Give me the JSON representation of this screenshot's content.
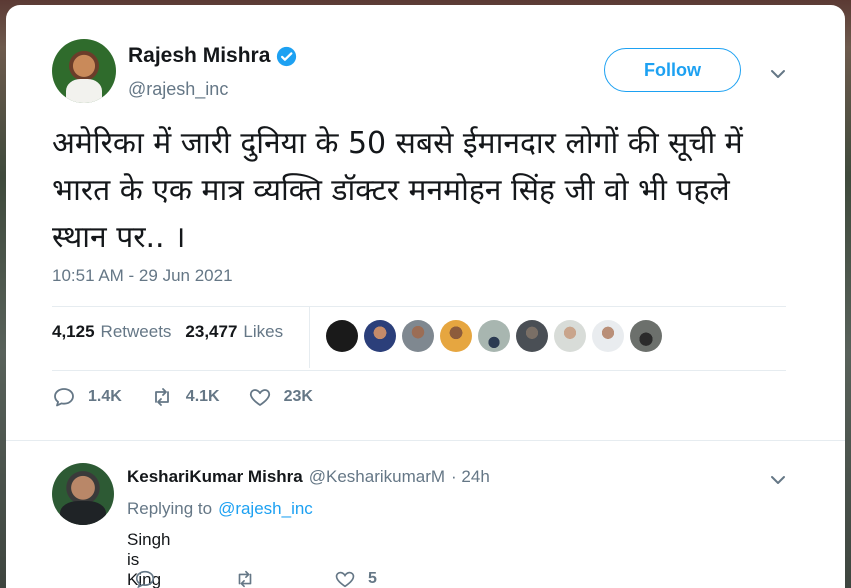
{
  "tweet": {
    "author_name": "Rajesh Mishra",
    "author_handle": "@rajesh_inc",
    "follow_label": "Follow",
    "text": "अमेरिका में जारी दुनिया के 50 सबसे ईमानदार लोगों की सूची में भारत के एक मात्र व्यक्ति डॉक्टर मनमोहन सिंह जी वो भी पहले स्थान पर.. ।",
    "timestamp": "10:51 AM - 29 Jun 2021",
    "retweets_count": "4,125",
    "retweets_label": "Retweets",
    "likes_count": "23,477",
    "likes_label": "Likes",
    "reply_count": "1.4K",
    "retweet_count_short": "4.1K",
    "like_count_short": "23K"
  },
  "reply": {
    "author_name": "KeshariKumar Mishra",
    "author_handle": "@KesharikumarM",
    "time": "· 24h",
    "replying_prefix": "Replying to",
    "replying_handle": "@rajesh_inc",
    "text": "Singh is King",
    "like_count": "5"
  },
  "colors": {
    "accent": "#1da1f2",
    "muted": "#657786",
    "text": "#14171a"
  },
  "icons": [
    "verified-badge-icon",
    "chevron-down-icon",
    "reply-icon",
    "retweet-icon",
    "like-icon"
  ]
}
